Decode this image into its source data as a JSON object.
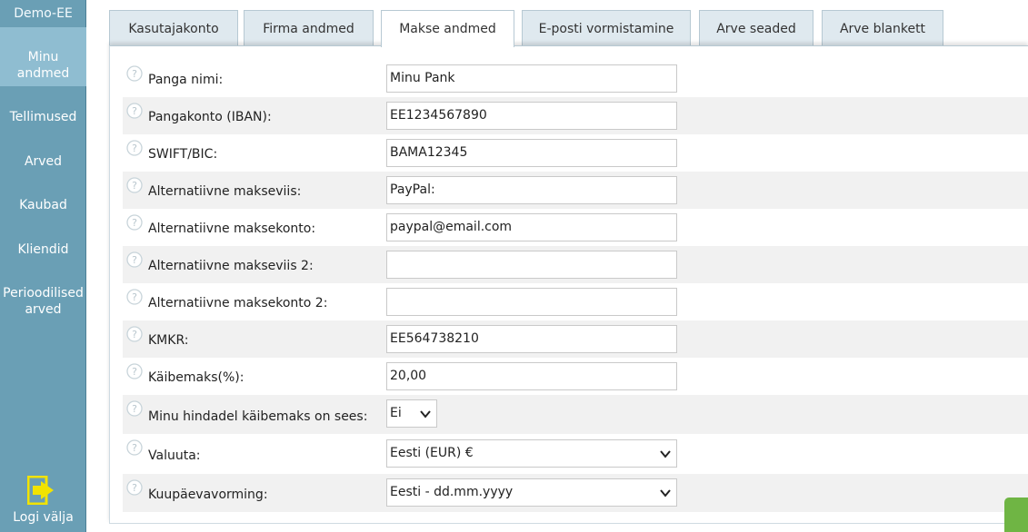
{
  "sidebar": {
    "company": "Demo-EE",
    "items": [
      {
        "label_line1": "Minu",
        "label_line2": "andmed"
      },
      {
        "label": "Tellimused"
      },
      {
        "label": "Arved"
      },
      {
        "label": "Kaubad"
      },
      {
        "label": "Kliendid"
      },
      {
        "label_line1": "Perioodilised",
        "label_line2": "arved"
      }
    ],
    "logout_label": "Logi välja"
  },
  "tabs": [
    {
      "label": "Kasutajakonto"
    },
    {
      "label": "Firma andmed"
    },
    {
      "label": "Makse andmed"
    },
    {
      "label": "E-posti vormistamine"
    },
    {
      "label": "Arve seaded"
    },
    {
      "label": "Arve blankett"
    }
  ],
  "form": {
    "rows": [
      {
        "label": "Panga nimi:",
        "value": "Minu Pank"
      },
      {
        "label": "Pangakonto (IBAN):",
        "value": "EE1234567890"
      },
      {
        "label": "SWIFT/BIC:",
        "value": "BAMA12345"
      },
      {
        "label": "Alternatiivne makseviis:",
        "value": "PayPal:"
      },
      {
        "label": "Alternatiivne maksekonto:",
        "value": "paypal@email.com"
      },
      {
        "label": "Alternatiivne makseviis 2:",
        "value": ""
      },
      {
        "label": "Alternatiivne maksekonto 2:",
        "value": ""
      },
      {
        "label": "KMKR:",
        "value": "EE564738210"
      },
      {
        "label": "Käibemaks(%):",
        "value": "20,00"
      },
      {
        "label": "Minu hindadel käibemaks on sees:",
        "value": "Ei"
      },
      {
        "label": "Valuuta:",
        "value": "Eesti (EUR) €"
      },
      {
        "label": "Kuupäevavorming:",
        "value": "Eesti - dd.mm.yyyy"
      }
    ]
  },
  "colors": {
    "sidebar_bg": "#6a9fb5",
    "sidebar_active": "#8fbdd1",
    "tab_bg": "#dfe9ef",
    "logout_icon": "#f2e300",
    "accent_green": "#6fb544"
  },
  "icons": {
    "help": "question-mark-circle-icon",
    "logout": "exit-door-arrow-icon",
    "dropdown": "chevron-down-icon"
  }
}
